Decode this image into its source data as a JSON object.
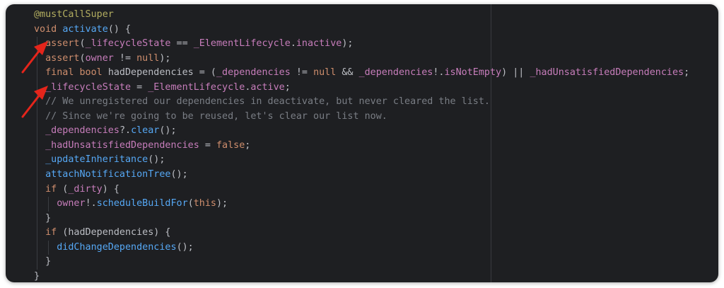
{
  "editor": {
    "theme_colors": {
      "background": "#1e1f22",
      "keyword": "#cf8e6d",
      "function": "#56a8f5",
      "field": "#c77dbb",
      "comment": "#7a7e85",
      "annotation": "#b3ae60",
      "arrow": "#e5251b"
    },
    "lines": [
      {
        "indent": 0,
        "tokens": [
          {
            "t": "an",
            "v": "@mustCallSuper"
          }
        ]
      },
      {
        "indent": 0,
        "tokens": [
          {
            "t": "kw",
            "v": "void "
          },
          {
            "t": "fn",
            "v": "activate"
          },
          {
            "t": "",
            "v": "() {"
          }
        ]
      },
      {
        "indent": 1,
        "tokens": [
          {
            "t": "kw",
            "v": "assert"
          },
          {
            "t": "",
            "v": "("
          },
          {
            "t": "fld",
            "v": "_lifecycleState"
          },
          {
            "t": "",
            "v": " == "
          },
          {
            "t": "cls",
            "v": "_ElementLifecycle"
          },
          {
            "t": "",
            "v": "."
          },
          {
            "t": "en",
            "v": "inactive"
          },
          {
            "t": "",
            "v": ");"
          }
        ]
      },
      {
        "indent": 1,
        "tokens": [
          {
            "t": "kw",
            "v": "assert"
          },
          {
            "t": "",
            "v": "("
          },
          {
            "t": "fld",
            "v": "owner"
          },
          {
            "t": "",
            "v": " != "
          },
          {
            "t": "kw",
            "v": "null"
          },
          {
            "t": "",
            "v": ");"
          }
        ]
      },
      {
        "indent": 1,
        "tokens": [
          {
            "t": "kw",
            "v": "final bool "
          },
          {
            "t": "",
            "v": "hadDependencies = ("
          },
          {
            "t": "fld",
            "v": "_dependencies"
          },
          {
            "t": "",
            "v": " != "
          },
          {
            "t": "kw",
            "v": "null"
          },
          {
            "t": "",
            "v": " && "
          },
          {
            "t": "fld",
            "v": "_dependencies"
          },
          {
            "t": "",
            "v": "!."
          },
          {
            "t": "fld",
            "v": "isNotEmpty"
          },
          {
            "t": "",
            "v": ") || "
          },
          {
            "t": "fld",
            "v": "_hadUnsatisfiedDependencies"
          },
          {
            "t": "",
            "v": ";"
          }
        ]
      },
      {
        "indent": 1,
        "tokens": [
          {
            "t": "fld",
            "v": "_lifecycleState"
          },
          {
            "t": "",
            "v": " = "
          },
          {
            "t": "cls",
            "v": "_ElementLifecycle"
          },
          {
            "t": "",
            "v": "."
          },
          {
            "t": "en",
            "v": "active"
          },
          {
            "t": "",
            "v": ";"
          }
        ]
      },
      {
        "indent": 1,
        "tokens": [
          {
            "t": "cm",
            "v": "// We unregistered our dependencies in deactivate, but never cleared the list."
          }
        ]
      },
      {
        "indent": 1,
        "tokens": [
          {
            "t": "cm",
            "v": "// Since we're going to be reused, let's clear our list now."
          }
        ]
      },
      {
        "indent": 1,
        "tokens": [
          {
            "t": "fld",
            "v": "_dependencies"
          },
          {
            "t": "",
            "v": "?."
          },
          {
            "t": "fn",
            "v": "clear"
          },
          {
            "t": "",
            "v": "();"
          }
        ]
      },
      {
        "indent": 1,
        "tokens": [
          {
            "t": "fld",
            "v": "_hadUnsatisfiedDependencies"
          },
          {
            "t": "",
            "v": " = "
          },
          {
            "t": "kw",
            "v": "false"
          },
          {
            "t": "",
            "v": ";"
          }
        ]
      },
      {
        "indent": 1,
        "tokens": [
          {
            "t": "fn",
            "v": "_updateInheritance"
          },
          {
            "t": "",
            "v": "();"
          }
        ]
      },
      {
        "indent": 1,
        "tokens": [
          {
            "t": "fn",
            "v": "attachNotificationTree"
          },
          {
            "t": "",
            "v": "();"
          }
        ]
      },
      {
        "indent": 1,
        "tokens": [
          {
            "t": "kw",
            "v": "if"
          },
          {
            "t": "",
            "v": " ("
          },
          {
            "t": "fld",
            "v": "_dirty"
          },
          {
            "t": "",
            "v": ") {"
          }
        ]
      },
      {
        "indent": 2,
        "tokens": [
          {
            "t": "fld",
            "v": "owner"
          },
          {
            "t": "",
            "v": "!."
          },
          {
            "t": "fn",
            "v": "scheduleBuildFor"
          },
          {
            "t": "",
            "v": "("
          },
          {
            "t": "kw",
            "v": "this"
          },
          {
            "t": "",
            "v": ");"
          }
        ]
      },
      {
        "indent": 1,
        "tokens": [
          {
            "t": "",
            "v": "}"
          }
        ]
      },
      {
        "indent": 1,
        "tokens": [
          {
            "t": "kw",
            "v": "if"
          },
          {
            "t": "",
            "v": " (hadDependencies) {"
          }
        ]
      },
      {
        "indent": 2,
        "tokens": [
          {
            "t": "fn",
            "v": "didChangeDependencies"
          },
          {
            "t": "",
            "v": "();"
          }
        ]
      },
      {
        "indent": 1,
        "tokens": [
          {
            "t": "",
            "v": "}"
          }
        ]
      },
      {
        "indent": 0,
        "tokens": [
          {
            "t": "",
            "v": "}"
          }
        ]
      }
    ]
  },
  "annotations": [
    {
      "name": "red-arrow-1",
      "points_to_line": 3
    },
    {
      "name": "red-arrow-2",
      "points_to_line": 6
    }
  ]
}
